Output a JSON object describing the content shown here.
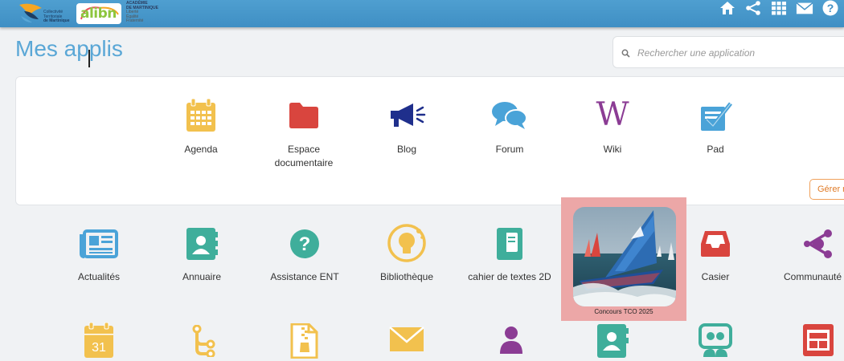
{
  "header": {
    "collectivity_lines": [
      "Collectivité",
      "Territoriale",
      "de Martinique"
    ],
    "ent_logo": "alibn",
    "academie_lines": [
      "ACADÉMIE",
      "DE MARTINIQUE"
    ],
    "academie_sub": [
      "Liberté",
      "Égalité",
      "Fraternité"
    ],
    "icons": [
      "home-icon",
      "share-icon",
      "apps-grid-icon",
      "mail-icon",
      "help-icon"
    ]
  },
  "page": {
    "title": "Mes applis"
  },
  "search": {
    "placeholder": "Rechercher une application"
  },
  "favorites": {
    "manage_label": "Gérer m",
    "apps": [
      {
        "label": "Agenda",
        "icon": "calendar-icon",
        "color": "#f2c14e"
      },
      {
        "label": "Espace documentaire",
        "icon": "folder-icon",
        "color": "#d9453e"
      },
      {
        "label": "Blog",
        "icon": "megaphone-icon",
        "color": "#1f2f8c"
      },
      {
        "label": "Forum",
        "icon": "chat-bubbles-icon",
        "color": "#4aa3d8"
      },
      {
        "label": "Wiki",
        "icon": "wiki-w-icon",
        "color": "#8b3c94"
      },
      {
        "label": "Pad",
        "icon": "pad-check-icon",
        "color": "#4aa3d8"
      }
    ]
  },
  "apps_row1": [
    {
      "label": "Actualités",
      "icon": "newspaper-icon",
      "color": "#4aa3d8"
    },
    {
      "label": "Annuaire",
      "icon": "contact-book-icon",
      "color": "#3fae9b"
    },
    {
      "label": "Assistance ENT",
      "icon": "question-circle-icon",
      "color": "#3fae9b"
    },
    {
      "label": "Bibliothèque",
      "icon": "lightbulb-icon",
      "color": "#f2c14e"
    },
    {
      "label": "cahier de textes 2D",
      "icon": "notebook-icon",
      "color": "#3fae9b"
    },
    {
      "label": "Concours TCO 2025",
      "icon": "sailboat-photo",
      "color": "#3a6fb5"
    },
    {
      "label": "Casier",
      "icon": "inbox-tray-icon",
      "color": "#d9453e"
    },
    {
      "label": "Communauté",
      "icon": "community-share-icon",
      "color": "#8b3c94"
    }
  ],
  "apps_row2": [
    {
      "icon": "calendar-31-icon",
      "color": "#f2c14e",
      "day": "31"
    },
    {
      "icon": "tree-branch-icon",
      "color": "#f2c14e"
    },
    {
      "icon": "zip-file-icon",
      "color": "#f2c14e"
    },
    {
      "icon": "envelope-icon",
      "color": "#f2c14e"
    },
    {
      "icon": "user-icon",
      "color": "#8b3c94"
    },
    {
      "icon": "contact-card-icon",
      "color": "#3fae9b"
    },
    {
      "icon": "presentation-icon",
      "color": "#3fae9b"
    },
    {
      "icon": "board-window-icon",
      "color": "#d9453e"
    }
  ]
}
